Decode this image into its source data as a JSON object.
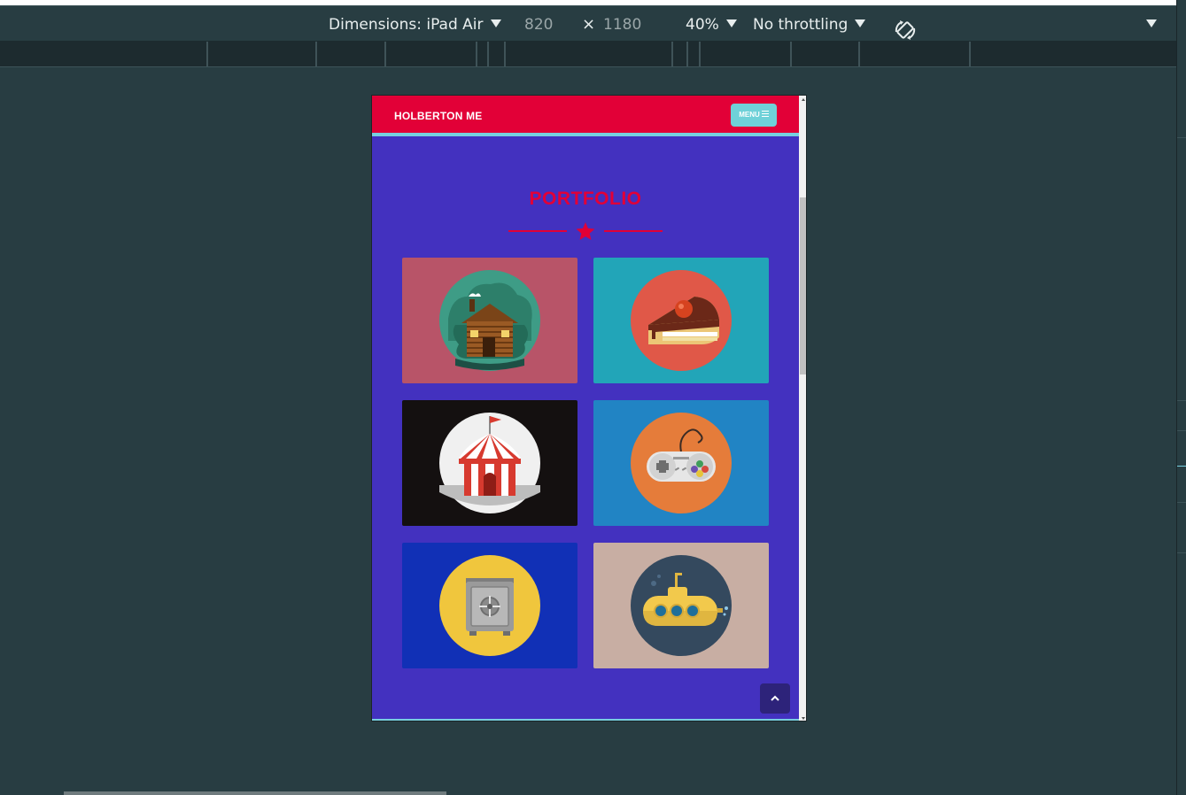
{
  "devtools": {
    "dimensions_label": "Dimensions: iPad Air",
    "width": "820",
    "times": "×",
    "height": "1180",
    "zoom": "40%",
    "throttling": "No throttling",
    "icons": [
      "chevron-down-icon",
      "rotate-icon"
    ]
  },
  "site": {
    "brand": "HOLBERTON ME",
    "menu_label": "MENU",
    "section_title": "PORTFOLIO",
    "colors": {
      "navbar": "#e20037",
      "accent_line": "#77cfe0",
      "page_background": "#4331bf",
      "menu_button": "#6fd1d8",
      "scroll_top_button": "#2d237a"
    },
    "portfolio": [
      {
        "icon": "cabin-icon",
        "background": "#b85468"
      },
      {
        "icon": "cake-slice-icon",
        "background": "#22a5b8"
      },
      {
        "icon": "circus-tent-icon",
        "background": "#141010"
      },
      {
        "icon": "gamepad-icon",
        "background": "#2184c4"
      },
      {
        "icon": "safe-icon",
        "background": "#1130b6"
      },
      {
        "icon": "submarine-icon",
        "background": "#c8aea3"
      }
    ],
    "scroll_top_icon": "chevron-up-icon"
  }
}
